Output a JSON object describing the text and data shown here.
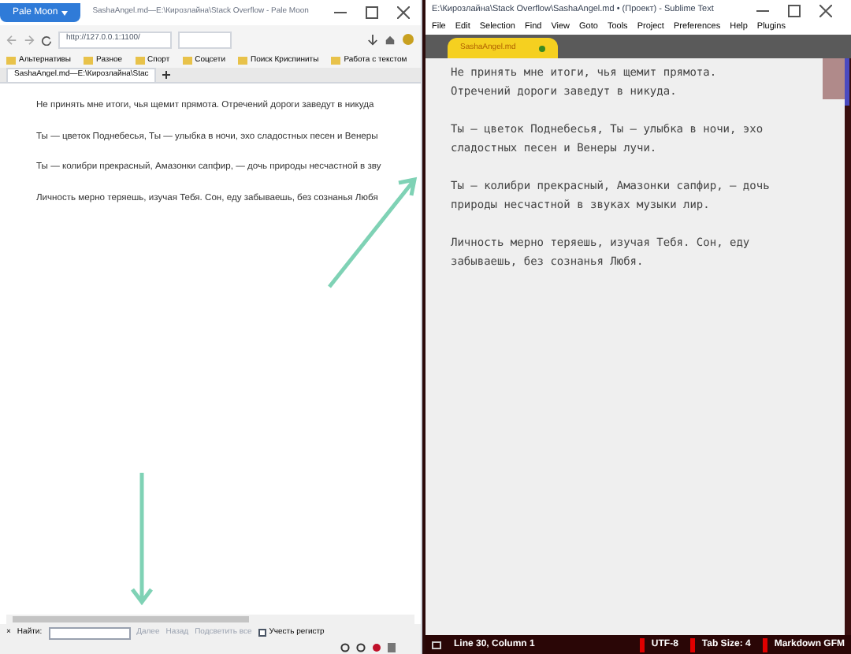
{
  "browser": {
    "menu_button": "Pale Moon",
    "title": "SashaAngel.md—E:\\Кирозлайна\\Stack Overflow - Pale Moon",
    "url": "http://127.0.0.1:1100/",
    "bookmarks": [
      "Альтернативы",
      "Разное",
      "Спорт",
      "Соцсети",
      "Поиск Криспиниты",
      "Работа с текстом"
    ],
    "tabs": [
      {
        "label": "SashaAngel.md—E:\\Кирозлайна\\Stac",
        "selected": true
      }
    ],
    "content": [
      "Не принять мне итоги, чья щемит прямота. Отречений дороги заведут в никуда",
      "Ты — цветок Поднебесья, Ты — улыбка в ночи, эхо сладостных песен и Венеры",
      "Ты — колибри прекрасный, Амазонки сапфир, — дочь природы несчастной в зву",
      "Личность мерно теряешь, изучая Тебя. Сон, еду забываешь, без сознанья Любя"
    ],
    "find_bar": {
      "close": "×",
      "label": "Найти:",
      "buttons": [
        {
          "label": "Далее",
          "disabled": true
        },
        {
          "label": "Назад",
          "disabled": true
        },
        {
          "label": "Подсветить все",
          "disabled": true
        }
      ],
      "match_case": {
        "label": "Учесть регистр",
        "checked": false
      }
    }
  },
  "editor": {
    "title": "E:\\Кирозлайна\\Stack Overflow\\SashaAngel.md • (Проект) - Sublime Text",
    "menu": [
      "File",
      "Edit",
      "Selection",
      "Find",
      "View",
      "Goto",
      "Tools",
      "Project",
      "Preferences",
      "Help",
      "Plugins"
    ],
    "tabs": [
      {
        "label": "SashaAngel.md",
        "selected": true,
        "modified": true
      }
    ],
    "paragraphs": [
      [
        "Не принять мне итоги, чья щемит прямота.",
        "Отречений дороги заведут в никуда."
      ],
      [
        "Ты — цветок Поднебесья, Ты — улыбка в ночи, эхо",
        "сладостных песен и Венеры лучи."
      ],
      [
        "Ты — колибри прекрасный, Амазонки сапфир, — дочь",
        "природы несчастной в звуках музыки лир."
      ],
      [
        "Личность мерно теряешь, изучая Тебя. Сон, еду",
        "забываешь, без сознанья Любя."
      ]
    ],
    "status": {
      "position": "Line 30, Column 1",
      "items": [
        "UTF-8",
        "Tab Size: 4",
        "Markdown GFM"
      ]
    }
  }
}
